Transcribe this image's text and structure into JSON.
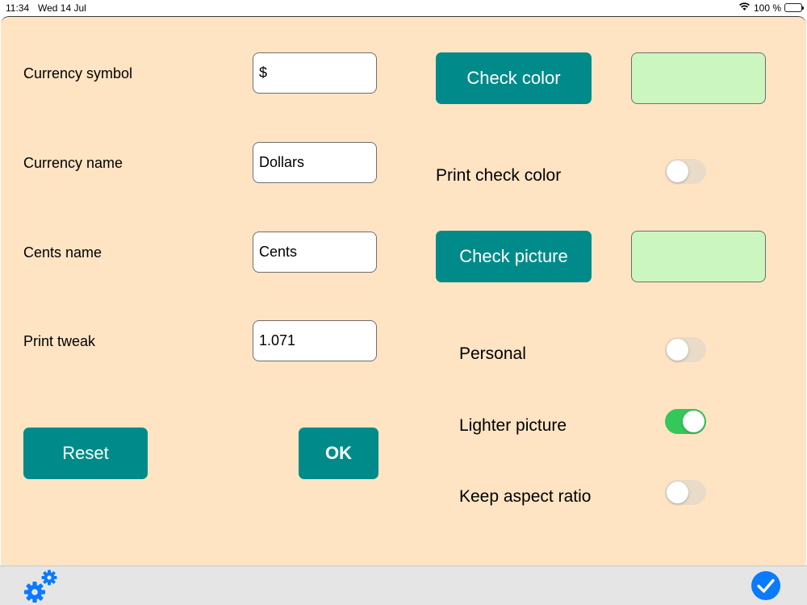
{
  "status_bar": {
    "time": "11:34",
    "date": "Wed 14 Jul",
    "battery": "100 %"
  },
  "settings": {
    "currency_symbol": {
      "label": "Currency symbol",
      "value": "$"
    },
    "currency_name": {
      "label": "Currency name",
      "value": "Dollars"
    },
    "cents_name": {
      "label": "Cents name",
      "value": "Cents"
    },
    "print_tweak": {
      "label": "Print tweak",
      "value": "1.071"
    },
    "reset_label": "Reset",
    "ok_label": "OK"
  },
  "check": {
    "color_button": "Check color",
    "color_swatch": "#ccf6c0",
    "print_check_color": {
      "label": "Print check color",
      "on": false
    },
    "picture_button": "Check picture",
    "picture_swatch": "#ccf6c0",
    "personal": {
      "label": "Personal",
      "on": false
    },
    "lighter_picture": {
      "label": "Lighter picture",
      "on": true
    },
    "keep_aspect_ratio": {
      "label": "Keep aspect ratio",
      "on": false
    }
  },
  "colors": {
    "background": "#ffe4c4",
    "accent": "#008b8a",
    "toggle_on": "#34c759",
    "toolbar_icon": "#0a7aff"
  },
  "toolbar": {
    "left_icon": "gears-icon",
    "right_icon": "checkmark-circle-icon"
  }
}
